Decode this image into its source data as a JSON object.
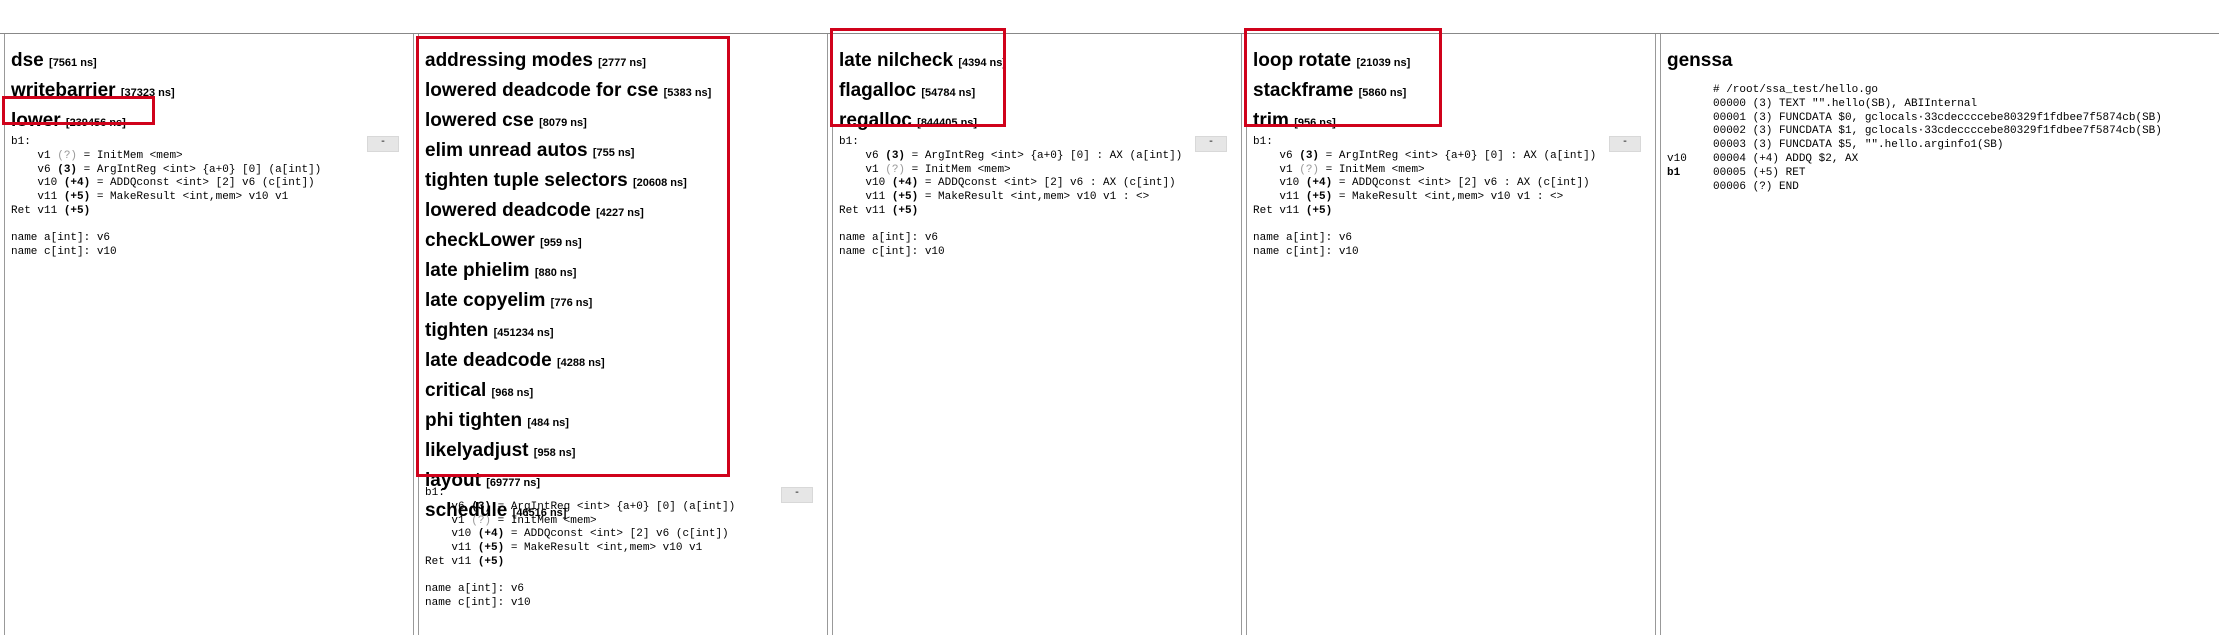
{
  "columns": [
    {
      "passes": [
        {
          "name": "dse",
          "time": "[7561 ns]"
        },
        {
          "name": "writebarrier",
          "time": "[37323 ns]"
        },
        {
          "name": "lower",
          "time": "[239456 ns]"
        }
      ],
      "collapse_label": "-",
      "block": "b1:",
      "lines": [
        {
          "p": "v1 ",
          "n": "(?)",
          "s": " = InitMem <mem>",
          "gray": true
        },
        {
          "p": "v6 ",
          "n": "(3)",
          "s": " = ArgIntReg <int> {a+0} [0] (a[int])",
          "gray": false
        },
        {
          "p": "v10 ",
          "n": "(+4)",
          "s": " = ADDQconst <int> [2] v6 (c[int])",
          "gray": false
        },
        {
          "p": "v11 ",
          "n": "(+5)",
          "s": " = MakeResult <int,mem> v10 v1",
          "gray": false
        }
      ],
      "ret": {
        "p": "Ret v11 ",
        "n": "(+5)"
      },
      "names": [
        "name a[int]: v6",
        "name c[int]: v10"
      ]
    },
    {
      "passes": [
        {
          "name": "addressing modes",
          "time": "[2777 ns]"
        },
        {
          "name": "lowered deadcode for cse",
          "time": "[5383 ns]"
        },
        {
          "name": "lowered cse",
          "time": "[8079 ns]"
        },
        {
          "name": "elim unread autos",
          "time": "[755 ns]"
        },
        {
          "name": "tighten tuple selectors",
          "time": "[20608 ns]"
        },
        {
          "name": "lowered deadcode",
          "time": "[4227 ns]"
        },
        {
          "name": "checkLower",
          "time": "[959 ns]"
        },
        {
          "name": "late phielim",
          "time": "[880 ns]"
        },
        {
          "name": "late copyelim",
          "time": "[776 ns]"
        },
        {
          "name": "tighten",
          "time": "[451234 ns]"
        },
        {
          "name": "late deadcode",
          "time": "[4288 ns]"
        },
        {
          "name": "critical",
          "time": "[968 ns]"
        },
        {
          "name": "phi tighten",
          "time": "[484 ns]"
        },
        {
          "name": "likelyadjust",
          "time": "[958 ns]"
        },
        {
          "name": "layout",
          "time": "[69777 ns]"
        },
        {
          "name": "schedule",
          "time": "[46516 ns]"
        }
      ],
      "collapse_label": "-",
      "block": "b1:",
      "lines": [
        {
          "p": "v6 ",
          "n": "(3)",
          "s": " = ArgIntReg <int> {a+0} [0] (a[int])",
          "gray": false
        },
        {
          "p": "v1 ",
          "n": "(?)",
          "s": " = InitMem <mem>",
          "gray": true
        },
        {
          "p": "v10 ",
          "n": "(+4)",
          "s": " = ADDQconst <int> [2] v6 (c[int])",
          "gray": false
        },
        {
          "p": "v11 ",
          "n": "(+5)",
          "s": " = MakeResult <int,mem> v10 v1",
          "gray": false
        }
      ],
      "ret": {
        "p": "Ret v11 ",
        "n": "(+5)"
      },
      "names": [
        "name a[int]: v6",
        "name c[int]: v10"
      ]
    },
    {
      "passes": [
        {
          "name": "late nilcheck",
          "time": "[4394 ns]"
        },
        {
          "name": "flagalloc",
          "time": "[54784 ns]"
        },
        {
          "name": "regalloc",
          "time": "[844405 ns]"
        }
      ],
      "collapse_label": "-",
      "block": "b1:",
      "lines": [
        {
          "p": "v6 ",
          "n": "(3)",
          "s": " = ArgIntReg <int> {a+0} [0] : AX (a[int])",
          "gray": false
        },
        {
          "p": "v1 ",
          "n": "(?)",
          "s": " = InitMem <mem>",
          "gray": true
        },
        {
          "p": "v10 ",
          "n": "(+4)",
          "s": " = ADDQconst <int> [2] v6 : AX (c[int])",
          "gray": false
        },
        {
          "p": "v11 ",
          "n": "(+5)",
          "s": " = MakeResult <int,mem> v10 v1 : <>",
          "gray": false
        }
      ],
      "ret": {
        "p": "Ret v11 ",
        "n": "(+5)"
      },
      "names": [
        "name a[int]: v6",
        "name c[int]: v10"
      ]
    },
    {
      "passes": [
        {
          "name": "loop rotate",
          "time": "[21039 ns]"
        },
        {
          "name": "stackframe",
          "time": "[5860 ns]"
        },
        {
          "name": "trim",
          "time": "[956 ns]"
        }
      ],
      "collapse_label": "-",
      "block": "b1:",
      "lines": [
        {
          "p": "v6 ",
          "n": "(3)",
          "s": " = ArgIntReg <int> {a+0} [0] : AX (a[int])",
          "gray": false
        },
        {
          "p": "v1 ",
          "n": "(?)",
          "s": " = InitMem <mem>",
          "gray": true
        },
        {
          "p": "v10 ",
          "n": "(+4)",
          "s": " = ADDQconst <int> [2] v6 : AX (c[int])",
          "gray": false
        },
        {
          "p": "v11 ",
          "n": "(+5)",
          "s": " = MakeResult <int,mem> v10 v1 : <>",
          "gray": false
        }
      ],
      "ret": {
        "p": "Ret v11 ",
        "n": "(+5)"
      },
      "names": [
        "name a[int]: v6",
        "name c[int]: v10"
      ]
    }
  ],
  "genssa": {
    "title": "genssa",
    "rows": [
      {
        "lbl": "",
        "txt": "# /root/ssa_test/hello.go"
      },
      {
        "lbl": "",
        "txt": "00000 (3) TEXT \"\".hello(SB), ABIInternal"
      },
      {
        "lbl": "",
        "txt": "00001 (3) FUNCDATA $0, gclocals·33cdeccccebe80329f1fdbee7f5874cb(SB)"
      },
      {
        "lbl": "",
        "txt": "00002 (3) FUNCDATA $1, gclocals·33cdeccccebe80329f1fdbee7f5874cb(SB)"
      },
      {
        "lbl": "",
        "txt": "00003 (3) FUNCDATA $5, \"\".hello.arginfo1(SB)"
      },
      {
        "lbl": "v10",
        "txt": "00004 (+4) ADDQ $2, AX"
      },
      {
        "lbl": "b1",
        "txt": "00005 (+5) RET"
      },
      {
        "lbl": "",
        "txt": "00006 (?) END"
      }
    ]
  },
  "colors": {
    "highlight": "#d0021b",
    "gray": "#999999"
  }
}
